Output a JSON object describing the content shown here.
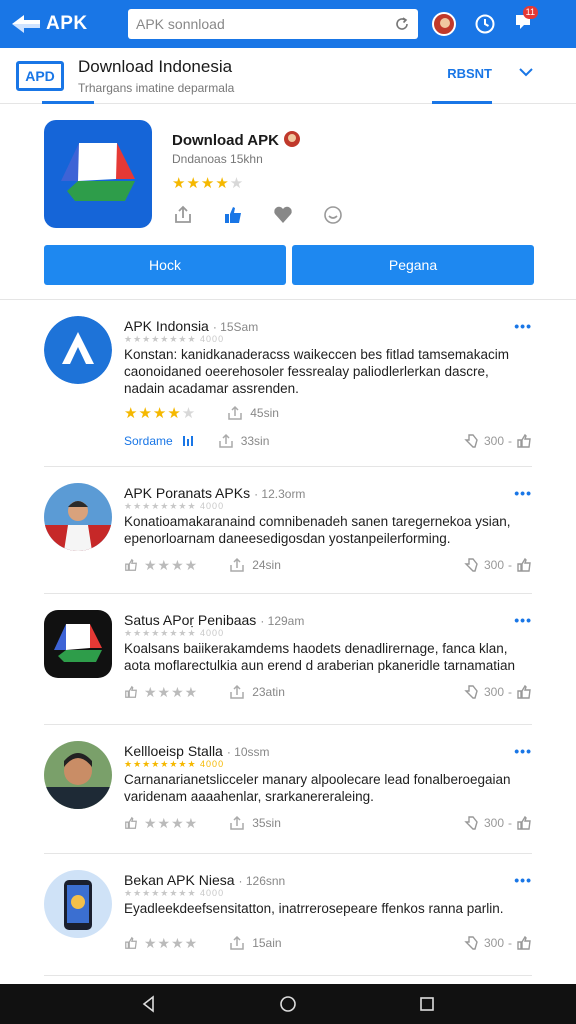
{
  "topbar": {
    "logo_text": "APK",
    "search_placeholder": "APK sonnload"
  },
  "section": {
    "logo_text": "APD",
    "title": "Download Indonesia",
    "subtitle": "Trhargans imatine deparmala",
    "reset_label": "RBSNT"
  },
  "app": {
    "name": "Download APK",
    "size": "Dndanoas 15khn",
    "rating": 4,
    "buttons": {
      "left": "Hock",
      "right": "Pegana"
    }
  },
  "reviews": [
    {
      "author": "APK Indonsia",
      "time": "· 15Sam",
      "meta": "★★★★★★★★ 4000",
      "text": "Konstan: kanidkanaderacss waikeccen bes fitlad tamsemakacim caonoidaned oeerehosoler fessrealay paliodlerlerkan dascre, nadain acadamar assrenden.",
      "rating": 4,
      "count1": "45sin",
      "tag": "Sordame",
      "count2": "33sin",
      "vote": "300"
    },
    {
      "author": "APK Poranats APKs",
      "time": "· 12.3orm",
      "meta": "★★★★★★★★ 4000",
      "text": "Konatioamakaranaind comnibenadeh sanen taregernekoa ysian, epenorloarnam daneesedigosdan yostanpeilerforming.",
      "count1": "24sin",
      "vote": "300"
    },
    {
      "author": "Satus APoṛ Penibaas",
      "time": "· 129am",
      "meta": "★★★★★★★★ 4000",
      "text": "Koalsans baiikerakamdems haodets denadlirernage, fanca klan, aota moflarectulkia aun erend d araberian pkaneridle tarnamatian",
      "count1": "23atin",
      "vote": "300"
    },
    {
      "author": "Kellloeisp Stalla",
      "time": "· 10ssm",
      "meta": "★★★★★★★★ 4000",
      "text": "Carnanarianetslicceler manary alpoolecare lead fonalberoegaian varidenam aaaahenlar, srarkanereraleing.",
      "count1": "35sin",
      "vote": "300"
    },
    {
      "author": "Bekan APK Niesa",
      "time": "· 126snn",
      "meta": "★★★★★★★★ 4000",
      "text": "Eyadleekdeefsensitatton, inatrrerosepeare ffenkos ranna parlin.",
      "count1": "15ain",
      "vote": "300"
    }
  ],
  "colors": {
    "accent": "#1976e6",
    "button": "#1e88f0",
    "star": "#f5b800"
  }
}
